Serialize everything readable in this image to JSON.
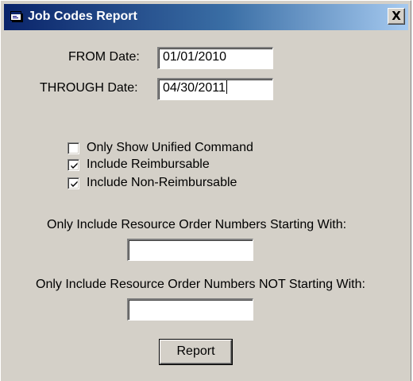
{
  "window": {
    "title": "Job Codes Report",
    "icon": "app-window-icon",
    "close_label": "X"
  },
  "form": {
    "from_date": {
      "label": "FROM Date:",
      "value": "01/01/2010"
    },
    "through_date": {
      "label": "THROUGH Date:",
      "value": "04/30/2011"
    },
    "unified_command": {
      "label": "Only Show Unified Command",
      "checked": false
    },
    "include_reimbursable": {
      "label": "Include Reimbursable",
      "checked": true
    },
    "include_non_reimbursable": {
      "label": "Include Non-Reimbursable",
      "checked": true
    },
    "starting_with": {
      "label": "Only Include Resource Order Numbers Starting With:",
      "value": ""
    },
    "not_starting_with": {
      "label": "Only Include Resource Order Numbers NOT Starting With:",
      "value": ""
    },
    "report_button": "Report"
  },
  "colors": {
    "face": "#d4d0c8",
    "title_start": "#0a246a",
    "title_end": "#a6caf0"
  }
}
